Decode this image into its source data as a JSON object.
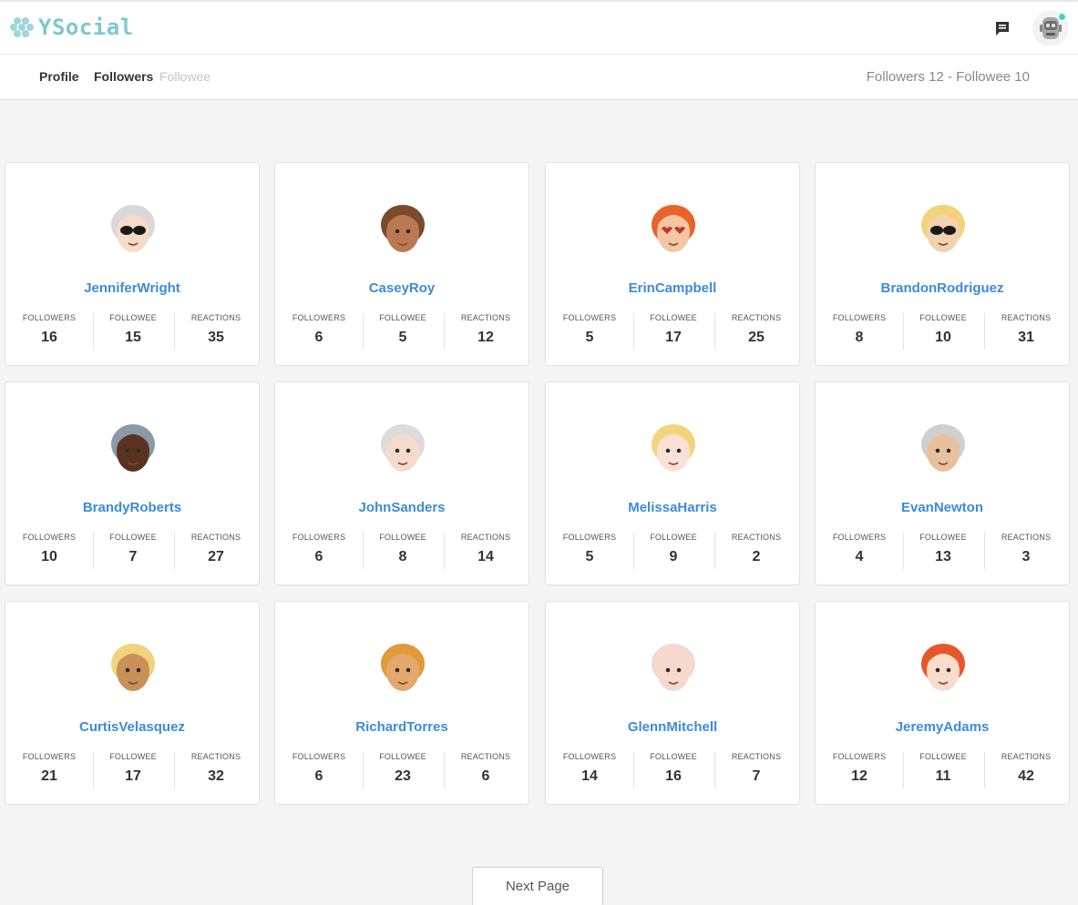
{
  "header": {
    "brand": "YSocial",
    "accent_color": "#7fc8cf",
    "icons": [
      "chat-icon",
      "robot-avatar-icon"
    ]
  },
  "subnav": {
    "tabs": [
      "Profile",
      "Followers",
      "Followee"
    ],
    "counts": "Followers 12 - Followee 10"
  },
  "stat_labels": {
    "followers": "FOLLOWERS",
    "followee": "FOLLOWEE",
    "reactions": "REACTIONS"
  },
  "users": [
    {
      "name": "JenniferWright",
      "followers": "16",
      "followee": "15",
      "reactions": "35",
      "skin": "#f6dcc8",
      "hair": "#d8d8d8",
      "glasses": "sun"
    },
    {
      "name": "CaseyRoy",
      "followers": "6",
      "followee": "5",
      "reactions": "12",
      "skin": "#b97a52",
      "hair": "#7a4a2a",
      "glasses": "none"
    },
    {
      "name": "ErinCampbell",
      "followers": "5",
      "followee": "17",
      "reactions": "25",
      "skin": "#f3c6a4",
      "hair": "#e8622a",
      "glasses": "heart"
    },
    {
      "name": "BrandonRodriguez",
      "followers": "8",
      "followee": "10",
      "reactions": "31",
      "skin": "#f3d2b0",
      "hair": "#f2d27a",
      "glasses": "sun"
    },
    {
      "name": "BrandyRoberts",
      "followers": "10",
      "followee": "7",
      "reactions": "27",
      "skin": "#5a3320",
      "hair": "#8a9aa6",
      "glasses": "none"
    },
    {
      "name": "JohnSanders",
      "followers": "6",
      "followee": "8",
      "reactions": "14",
      "skin": "#f4dccc",
      "hair": "#dcdcdc",
      "glasses": "none"
    },
    {
      "name": "MelissaHarris",
      "followers": "5",
      "followee": "9",
      "reactions": "2",
      "skin": "#fbe0d6",
      "hair": "#f3d47a",
      "glasses": "none"
    },
    {
      "name": "EvanNewton",
      "followers": "4",
      "followee": "13",
      "reactions": "3",
      "skin": "#e8c09e",
      "hair": "#cfcfcf",
      "glasses": "none"
    },
    {
      "name": "CurtisVelasquez",
      "followers": "21",
      "followee": "17",
      "reactions": "32",
      "skin": "#c99058",
      "hair": "#f0d37a",
      "glasses": "none"
    },
    {
      "name": "RichardTorres",
      "followers": "6",
      "followee": "23",
      "reactions": "6",
      "skin": "#e4a86e",
      "hair": "#e09a3a",
      "glasses": "none"
    },
    {
      "name": "GlennMitchell",
      "followers": "14",
      "followee": "16",
      "reactions": "7",
      "skin": "#f6d8cc",
      "hair": "#f6d8cc",
      "glasses": "none"
    },
    {
      "name": "JeremyAdams",
      "followers": "12",
      "followee": "11",
      "reactions": "42",
      "skin": "#f8dccc",
      "hair": "#e6582a",
      "glasses": "none"
    }
  ],
  "pagination": {
    "next_label": "Next Page"
  }
}
